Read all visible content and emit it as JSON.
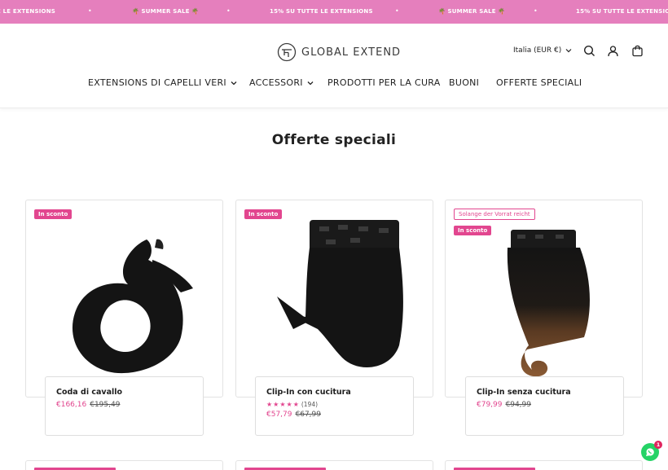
{
  "announcement": {
    "items": [
      "E LE EXTENSIONS",
      "🌴 SUMMER SALE 🌴",
      "15% SU TUTTE LE EXTENSIONS",
      "🌴 SUMMER SALE 🌴",
      "15% SU TUTTE LE EXTENSIONS"
    ],
    "separator": "•",
    "background_color": "#e57fbd"
  },
  "header": {
    "logo_text": "GLOBAL EXTEND",
    "country_selector": "Italia (EUR €)",
    "icons": [
      "search-icon",
      "account-icon",
      "cart-icon"
    ]
  },
  "nav": {
    "items": [
      {
        "label": "EXTENSIONS DI CAPELLI VERI",
        "has_dropdown": true
      },
      {
        "label": "ACCESSORI",
        "has_dropdown": true
      },
      {
        "label": "PRODOTTI PER LA CURA",
        "has_dropdown": false
      },
      {
        "label": "BUONI",
        "has_dropdown": false
      },
      {
        "label": "OFFERTE SPECIALI",
        "has_dropdown": false
      }
    ]
  },
  "page": {
    "title": "Offerte speciali"
  },
  "products": [
    {
      "badges": [
        "In sconto"
      ],
      "name": "Coda di cavallo",
      "rating_stars": "",
      "review_count": "",
      "price_sale": "€166,16",
      "price_old": "€195,49"
    },
    {
      "badges": [
        "In sconto"
      ],
      "name": "Clip-In con cucitura",
      "rating_stars": "★★★★★",
      "review_count": "(194)",
      "price_sale": "€57,79",
      "price_old": "€67,99"
    },
    {
      "badges": [
        "Solange der Vorrat reicht",
        "In sconto"
      ],
      "name": "Clip-In senza cucitura",
      "rating_stars": "",
      "review_count": "",
      "price_sale": "€79,99",
      "price_old": "€94,99"
    }
  ],
  "whatsapp": {
    "icon": "whatsapp-icon",
    "notification_count": "1"
  },
  "colors": {
    "accent": "#e2468f",
    "announcement_bg": "#e57fbd"
  }
}
